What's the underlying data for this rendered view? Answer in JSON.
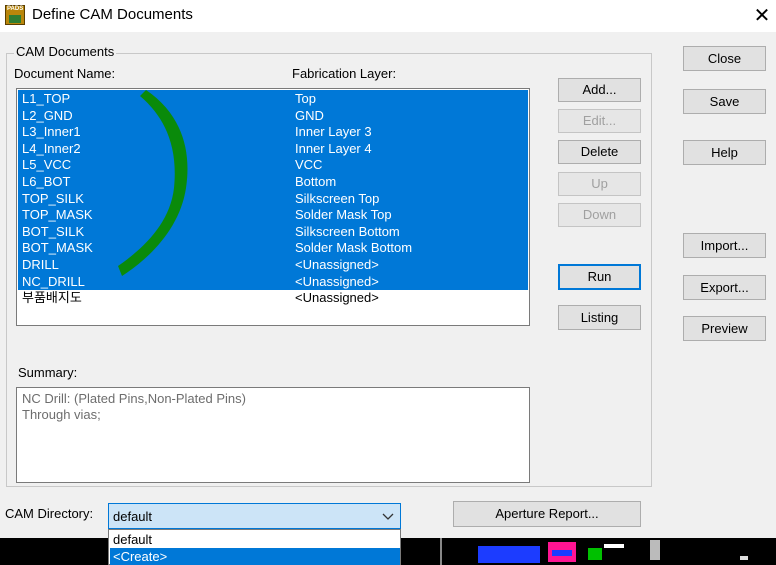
{
  "window": {
    "title": "Define CAM Documents",
    "app_icon_text": "PADS"
  },
  "cam_documents": {
    "group_label": "CAM Documents",
    "col_document": "Document Name:",
    "col_layer": "Fabrication Layer:",
    "rows": [
      {
        "name": "L1_TOP",
        "layer": "Top",
        "selected": true
      },
      {
        "name": "L2_GND",
        "layer": "GND",
        "selected": true
      },
      {
        "name": "L3_Inner1",
        "layer": "Inner Layer 3",
        "selected": true
      },
      {
        "name": "L4_Inner2",
        "layer": "Inner Layer 4",
        "selected": true
      },
      {
        "name": "L5_VCC",
        "layer": "VCC",
        "selected": true
      },
      {
        "name": "L6_BOT",
        "layer": "Bottom",
        "selected": true
      },
      {
        "name": "TOP_SILK",
        "layer": "Silkscreen Top",
        "selected": true
      },
      {
        "name": "TOP_MASK",
        "layer": "Solder Mask Top",
        "selected": true
      },
      {
        "name": "BOT_SILK",
        "layer": "Silkscreen Bottom",
        "selected": true
      },
      {
        "name": "BOT_MASK",
        "layer": "Solder Mask Bottom",
        "selected": true
      },
      {
        "name": "DRILL",
        "layer": "<Unassigned>",
        "selected": true
      },
      {
        "name": "NC_DRILL",
        "layer": "<Unassigned>",
        "selected": true
      },
      {
        "name": "부품배지도",
        "layer": "<Unassigned>",
        "selected": false
      }
    ]
  },
  "buttons": {
    "add": "Add...",
    "edit": "Edit...",
    "delete": "Delete",
    "up": "Up",
    "down": "Down",
    "run": "Run",
    "listing": "Listing",
    "close": "Close",
    "save": "Save",
    "help": "Help",
    "import": "Import...",
    "export": "Export...",
    "preview": "Preview",
    "aperture_report": "Aperture Report..."
  },
  "summary": {
    "label": "Summary:",
    "lines": [
      "NC Drill: (Plated Pins,Non-Plated Pins)",
      "Through vias;"
    ]
  },
  "cam_directory": {
    "label": "CAM Directory:",
    "value": "default",
    "options": [
      "default",
      "<Create>"
    ],
    "highlighted_option": "<Create>"
  },
  "colors": {
    "selection": "#0078d7",
    "annotation_stroke": "#0a8a0a"
  }
}
